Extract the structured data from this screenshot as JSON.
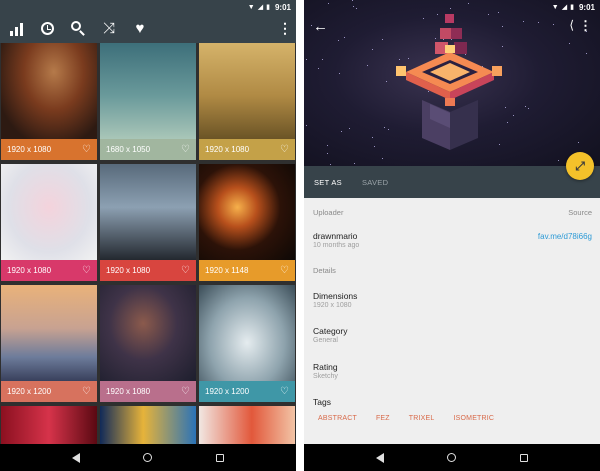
{
  "status": {
    "time": "9:01"
  },
  "gallery": {
    "toolbar_icons": [
      "bar-chart-icon",
      "history-icon",
      "search-icon",
      "shuffle-icon",
      "heart-icon",
      "more-vert-icon"
    ],
    "tiles": [
      {
        "res": "1920 x 1080",
        "caption_color": "#d8732e"
      },
      {
        "res": "1680 x 1050",
        "caption_color": "#a1b69f"
      },
      {
        "res": "1920 x 1080",
        "caption_color": "#c4a148"
      },
      {
        "res": "1920 x 1080",
        "caption_color": "#d8396a"
      },
      {
        "res": "1920 x 1080",
        "caption_color": "#d8453f"
      },
      {
        "res": "1920 x 1148",
        "caption_color": "#e79b2a"
      },
      {
        "res": "1920 x 1200",
        "caption_color": "#d7725e"
      },
      {
        "res": "1920 x 1080",
        "caption_color": "#b96f8c"
      },
      {
        "res": "1920 x 1200",
        "caption_color": "#3f97a7"
      },
      {
        "res": "",
        "caption_color": ""
      },
      {
        "res": "",
        "caption_color": ""
      },
      {
        "res": "",
        "caption_color": ""
      }
    ]
  },
  "detail": {
    "actions": {
      "set_as": "SET AS",
      "saved": "SAVED"
    },
    "uploader_head": "Uploader",
    "source_head": "Source",
    "uploader_name": "drawnmario",
    "uploader_time": "10 months ago",
    "source_link": "fav.me/d78i66g",
    "details_head": "Details",
    "dimensions_label": "Dimensions",
    "dimensions_value": "1920 x 1080",
    "category_label": "Category",
    "category_value": "General",
    "rating_label": "Rating",
    "rating_value": "Sketchy",
    "tags_head": "Tags",
    "tags": [
      "ABSTRACT",
      "FEZ",
      "TRIXEL",
      "ISOMETRIC"
    ]
  },
  "colors": {
    "toolbar": "#37434a",
    "fab": "#f4c12a",
    "link": "#2c9ad6",
    "tag": "#d86a4a"
  }
}
